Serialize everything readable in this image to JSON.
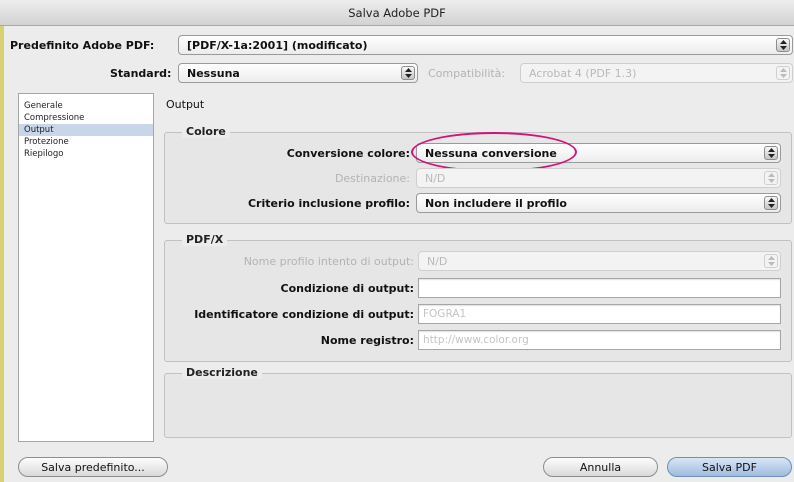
{
  "window": {
    "title": "Salva Adobe PDF"
  },
  "header": {
    "preset_label": "Predefinito Adobe PDF:",
    "preset_value": "[PDF/X-1a:2001] (modificato)",
    "standard_label": "Standard:",
    "standard_value": "Nessuna",
    "compat_label": "Compatibilità:",
    "compat_value": "Acrobat 4 (PDF 1.3)"
  },
  "sidebar": {
    "items": [
      {
        "label": "Generale"
      },
      {
        "label": "Compressione"
      },
      {
        "label": "Output"
      },
      {
        "label": "Protezione"
      },
      {
        "label": "Riepilogo"
      }
    ],
    "selected": "Output"
  },
  "main": {
    "section_title": "Output",
    "colore": {
      "title": "Colore",
      "conversion_label": "Conversione colore:",
      "conversion_value": "Nessuna conversione",
      "destination_label": "Destinazione:",
      "destination_value": "N/D",
      "profile_label": "Criterio inclusione profilo:",
      "profile_value": "Non includere il profilo"
    },
    "pdfx": {
      "title": "PDF/X",
      "intent_label": "Nome profilo intento di output:",
      "intent_value": "N/D",
      "condition_label": "Condizione di output:",
      "condition_value": "",
      "identifier_label": "Identificatore condizione di output:",
      "identifier_value": "FOGRA1",
      "registry_label": "Nome registro:",
      "registry_value": "http://www.color.org"
    },
    "description": {
      "title": "Descrizione"
    }
  },
  "footer": {
    "save_preset_label": "Salva predefinito...",
    "cancel_label": "Annulla",
    "save_pdf_label": "Salva PDF"
  },
  "colors": {
    "highlight": "#d1137c",
    "selected_row": "#c9d5e8"
  }
}
